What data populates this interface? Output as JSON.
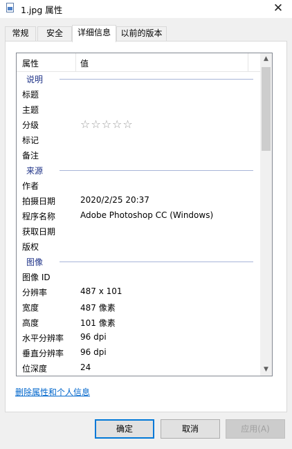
{
  "window": {
    "title": "1.jpg 属性",
    "close_symbol": "✕"
  },
  "tabs": [
    {
      "label": "常规"
    },
    {
      "label": "安全"
    },
    {
      "label": "详细信息"
    },
    {
      "label": "以前的版本"
    }
  ],
  "columns": {
    "property": "属性",
    "value": "值"
  },
  "sections": {
    "description": {
      "title": "说明",
      "rows": [
        {
          "label": "标题",
          "value": ""
        },
        {
          "label": "主题",
          "value": ""
        },
        {
          "label": "分级",
          "rating": 0,
          "rating_max": 5
        },
        {
          "label": "标记",
          "value": ""
        },
        {
          "label": "备注",
          "value": ""
        }
      ]
    },
    "origin": {
      "title": "来源",
      "rows": [
        {
          "label": "作者",
          "value": ""
        },
        {
          "label": "拍摄日期",
          "value": "2020/2/25 20:37"
        },
        {
          "label": "程序名称",
          "value": "Adobe Photoshop CC (Windows)"
        },
        {
          "label": "获取日期",
          "value": ""
        },
        {
          "label": "版权",
          "value": ""
        }
      ]
    },
    "image": {
      "title": "图像",
      "rows": [
        {
          "label": "图像 ID",
          "value": ""
        },
        {
          "label": "分辨率",
          "value": "487 x 101"
        },
        {
          "label": "宽度",
          "value": "487 像素"
        },
        {
          "label": "高度",
          "value": "101 像素"
        },
        {
          "label": "水平分辨率",
          "value": "96 dpi"
        },
        {
          "label": "垂直分辨率",
          "value": "96 dpi"
        },
        {
          "label": "位深度",
          "value": "24"
        }
      ]
    }
  },
  "scrollbar": {
    "position": 0.0
  },
  "remove_link": "删除属性和个人信息",
  "buttons": {
    "ok": "确定",
    "cancel": "取消",
    "apply": "应用(A)"
  }
}
